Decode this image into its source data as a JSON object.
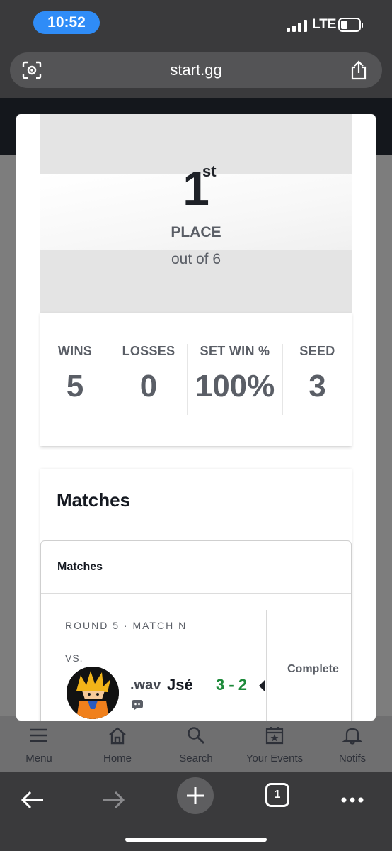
{
  "status_bar": {
    "time": "10:52",
    "network": "LTE"
  },
  "browser": {
    "url": "start.gg",
    "tab_count": "1"
  },
  "background_nav": [
    {
      "label": "Menu",
      "icon": "menu-icon"
    },
    {
      "label": "Home",
      "icon": "home-icon"
    },
    {
      "label": "Search",
      "icon": "search-icon"
    },
    {
      "label": "Your Events",
      "icon": "calendar-star-icon"
    },
    {
      "label": "Notifs",
      "icon": "bell-icon"
    }
  ],
  "placement": {
    "rank": "1",
    "suffix": "st",
    "label": "PLACE",
    "out_of": "out of 6"
  },
  "stats": [
    {
      "label": "WINS",
      "value": "5"
    },
    {
      "label": "LOSSES",
      "value": "0"
    },
    {
      "label": "SET WIN %",
      "value": "100%"
    },
    {
      "label": "SEED",
      "value": "3"
    }
  ],
  "matches": {
    "heading": "Matches",
    "box_title": "Matches",
    "items": [
      {
        "round": "ROUND 5 · MATCH N",
        "vs": "VS.",
        "player_prefix": ".wav",
        "player_name": "Jsé",
        "score": "3 - 2",
        "status": "Complete"
      }
    ]
  },
  "colors": {
    "win_score": "#1d8a3a",
    "url_pill": "#2f8cf7"
  }
}
